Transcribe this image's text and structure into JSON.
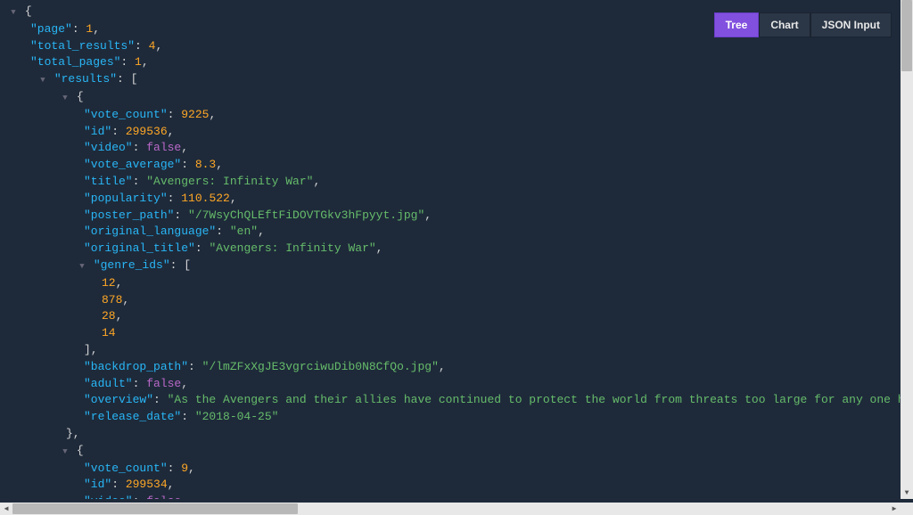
{
  "tabs": {
    "tree": "Tree",
    "chart": "Chart",
    "json_input": "JSON Input"
  },
  "keys": {
    "page": "\"page\"",
    "total_results": "\"total_results\"",
    "total_pages": "\"total_pages\"",
    "results": "\"results\"",
    "vote_count": "\"vote_count\"",
    "id": "\"id\"",
    "video": "\"video\"",
    "vote_average": "\"vote_average\"",
    "title": "\"title\"",
    "popularity": "\"popularity\"",
    "poster_path": "\"poster_path\"",
    "original_language": "\"original_language\"",
    "original_title": "\"original_title\"",
    "genre_ids": "\"genre_ids\"",
    "backdrop_path": "\"backdrop_path\"",
    "adult": "\"adult\"",
    "overview": "\"overview\"",
    "release_date": "\"release_date\""
  },
  "vals": {
    "page": "1",
    "total_results": "4",
    "total_pages": "1",
    "r0_vote_count": "9225",
    "r0_id": "299536",
    "r0_video": "false",
    "r0_vote_average": "8.3",
    "r0_title": "\"Avengers: Infinity War\"",
    "r0_popularity": "110.522",
    "r0_poster_path": "\"/7WsyChQLEftFiDOVTGkv3hFpyyt.jpg\"",
    "r0_original_language": "\"en\"",
    "r0_original_title": "\"Avengers: Infinity War\"",
    "r0_genre_0": "12",
    "r0_genre_1": "878",
    "r0_genre_2": "28",
    "r0_genre_3": "14",
    "r0_backdrop_path": "\"/lmZFxXgJE3vgrciwuDib0N8CfQo.jpg\"",
    "r0_adult": "false",
    "r0_overview": "\"As the Avengers and their allies have continued to protect the world from threats too large for any one hero to handle, a new danger has emerged",
    "r0_release_date": "\"2018-04-25\"",
    "r1_vote_count": "9",
    "r1_id": "299534",
    "r1_video": "false"
  },
  "syntax": {
    "open_brace": "{",
    "close_brace": "}",
    "open_bracket": "[",
    "close_bracket": "]",
    "close_bracket_comma": "],",
    "close_brace_comma": "},",
    "colon": ": ",
    "comma": ",",
    "toggle": "▼"
  }
}
